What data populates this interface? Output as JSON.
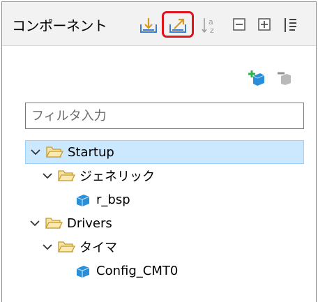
{
  "panel": {
    "title": "コンポーネント",
    "toolbar": [
      {
        "icon": "import-icon"
      },
      {
        "icon": "export-icon"
      },
      {
        "icon": "sort-alphabetical-icon"
      },
      {
        "icon": "collapse-all-icon"
      },
      {
        "icon": "expand-all-icon"
      },
      {
        "icon": "layout-icon"
      }
    ],
    "actions": [
      {
        "icon": "add-component-icon"
      },
      {
        "icon": "remove-component-icon"
      }
    ]
  },
  "filter": {
    "placeholder": "フィルタ入力",
    "value": ""
  },
  "tree": [
    {
      "label": "Startup",
      "type": "folder",
      "level": 0,
      "expanded": true,
      "selected": true
    },
    {
      "label": "ジェネリック",
      "type": "folder",
      "level": 1,
      "expanded": true
    },
    {
      "label": "r_bsp",
      "type": "component",
      "level": 2
    },
    {
      "label": "Drivers",
      "type": "folder",
      "level": 0,
      "expanded": true
    },
    {
      "label": "タイマ",
      "type": "folder",
      "level": 1,
      "expanded": true
    },
    {
      "label": "Config_CMT0",
      "type": "component",
      "level": 2
    }
  ],
  "colors": {
    "highlight": "#e0141e",
    "selection": "#cce8ff",
    "folder": "#f5d36a"
  }
}
